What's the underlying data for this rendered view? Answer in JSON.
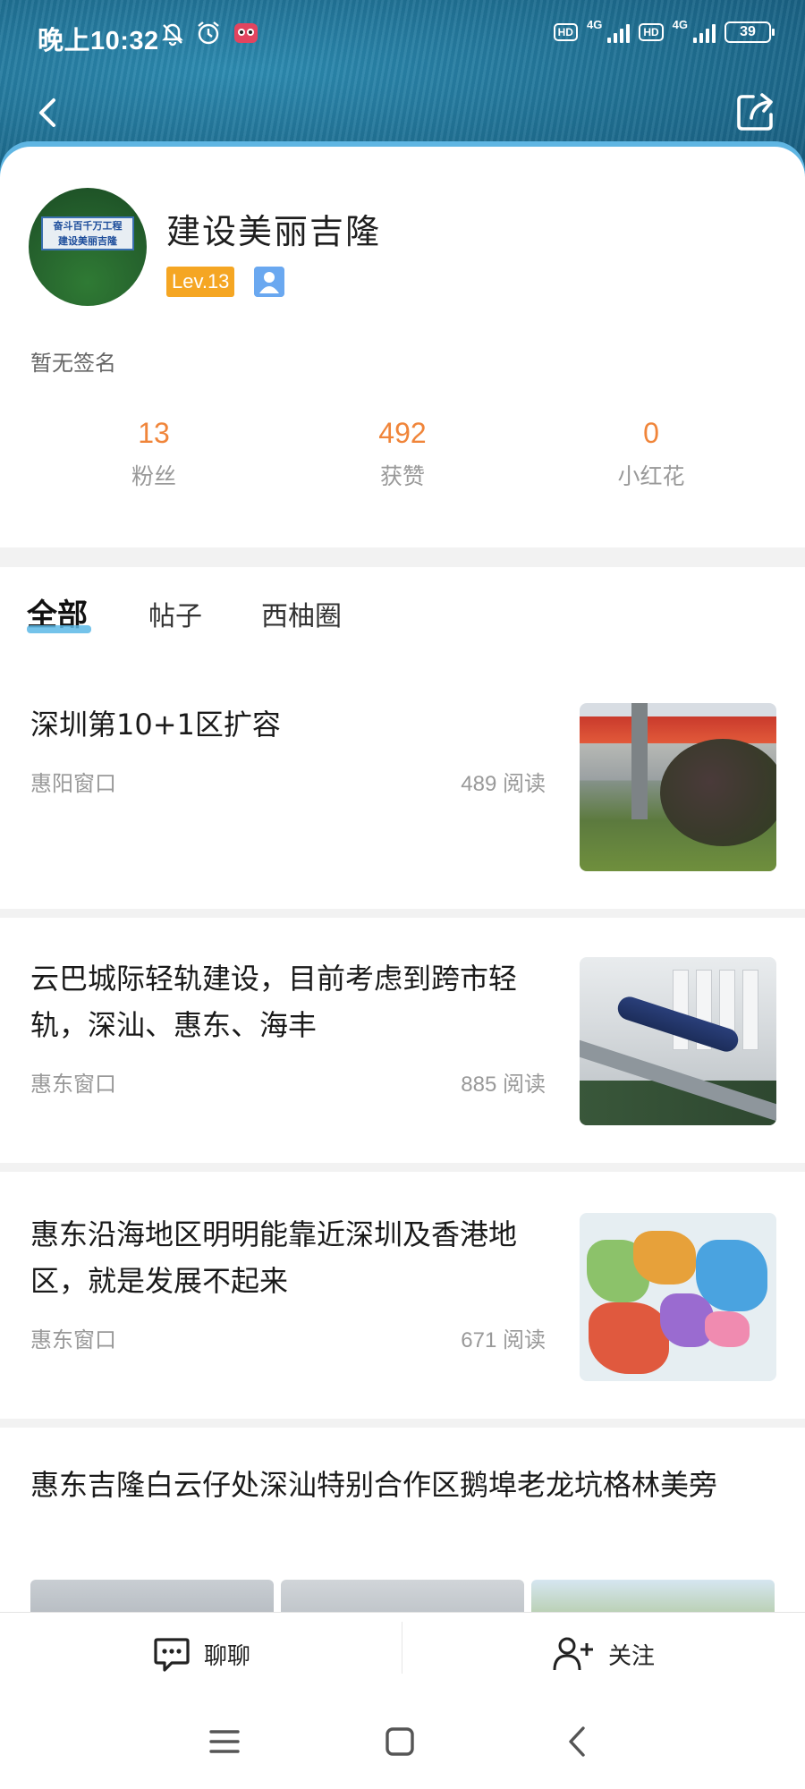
{
  "status_bar": {
    "time": "晚上10:32",
    "network_1": "4G",
    "network_2": "4G",
    "hd": "HD",
    "battery": "39"
  },
  "profile": {
    "username": "建设美丽吉隆",
    "avatar_text_1": "奋斗百千万工程",
    "avatar_text_2": "建设美丽吉隆",
    "level": "Lev.13",
    "signature": "暂无签名"
  },
  "stats": [
    {
      "value": "13",
      "label": "粉丝"
    },
    {
      "value": "492",
      "label": "获赞"
    },
    {
      "value": "0",
      "label": "小红花"
    }
  ],
  "tabs": [
    {
      "label": "全部",
      "active": true
    },
    {
      "label": "帖子",
      "active": false
    },
    {
      "label": "西柚圈",
      "active": false
    }
  ],
  "posts": [
    {
      "title": "深圳第10+1区扩容",
      "source": "惠阳窗口",
      "reads": "489 阅读"
    },
    {
      "title": "云巴城际轻轨建设，目前考虑到跨市轻轨，深汕、惠东、海丰",
      "source": "惠东窗口",
      "reads": "885 阅读"
    },
    {
      "title": "惠东沿海地区明明能靠近深圳及香港地区，就是发展不起来",
      "source": "惠东窗口",
      "reads": "671 阅读"
    },
    {
      "title": "惠东吉隆白云仔处深汕特别合作区鹅埠老龙坑格林美旁"
    }
  ],
  "actions": {
    "chat": "聊聊",
    "follow": "关注"
  },
  "colors": {
    "accent": "#f0853a",
    "level": "#f5a623",
    "tab_underline": "#5cb8e6"
  }
}
